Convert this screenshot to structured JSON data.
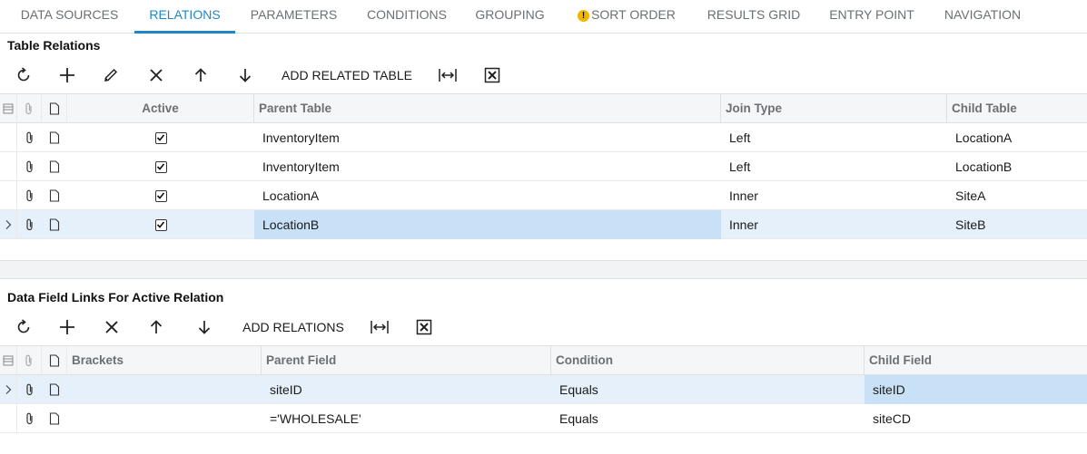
{
  "tabs": [
    {
      "label": "DATA SOURCES"
    },
    {
      "label": "RELATIONS"
    },
    {
      "label": "PARAMETERS"
    },
    {
      "label": "CONDITIONS"
    },
    {
      "label": "GROUPING"
    },
    {
      "label": "SORT ORDER",
      "warning": "!"
    },
    {
      "label": "RESULTS GRID"
    },
    {
      "label": "ENTRY POINT"
    },
    {
      "label": "NAVIGATION"
    }
  ],
  "active_tab": "RELATIONS",
  "relations": {
    "title": "Table Relations",
    "toolbar": {
      "refresh_icon": "refresh-icon",
      "add_icon": "plus-icon",
      "edit_icon": "pencil-icon",
      "delete_icon": "x-icon",
      "up_icon": "arrow-up-icon",
      "down_icon": "arrow-down-icon",
      "add_related_label": "ADD RELATED TABLE",
      "fit_icon": "fit-columns-icon",
      "export_icon": "excel-export-icon"
    },
    "columns": [
      "Active",
      "Parent Table",
      "Join Type",
      "Child Table"
    ],
    "rows": [
      {
        "active": true,
        "parent": "InventoryItem",
        "join": "Left",
        "child": "LocationA"
      },
      {
        "active": true,
        "parent": "InventoryItem",
        "join": "Left",
        "child": "LocationB"
      },
      {
        "active": true,
        "parent": "LocationA",
        "join": "Inner",
        "child": "SiteA"
      },
      {
        "active": true,
        "parent": "LocationB",
        "join": "Inner",
        "child": "SiteB"
      }
    ]
  },
  "links": {
    "title": "Data Field Links For Active Relation",
    "toolbar": {
      "refresh_icon": "refresh-icon",
      "add_icon": "plus-icon",
      "delete_icon": "x-icon",
      "up_icon": "arrow-up-icon",
      "down_icon": "arrow-down-icon",
      "add_relations_label": "ADD RELATIONS",
      "fit_icon": "fit-columns-icon",
      "export_icon": "excel-export-icon"
    },
    "columns": [
      "Brackets",
      "Parent Field",
      "Condition",
      "Child Field"
    ],
    "rows": [
      {
        "brackets": "",
        "parent": "siteID",
        "condition": "Equals",
        "child": "siteID"
      },
      {
        "brackets": "",
        "parent": "='WHOLESALE'",
        "condition": "Equals",
        "child": "siteCD"
      }
    ]
  },
  "colors": {
    "accent": "#1e88c7",
    "selected_row": "#e6f0fa",
    "selected_cell": "#c9e1f6",
    "warning": "#f2b600"
  }
}
